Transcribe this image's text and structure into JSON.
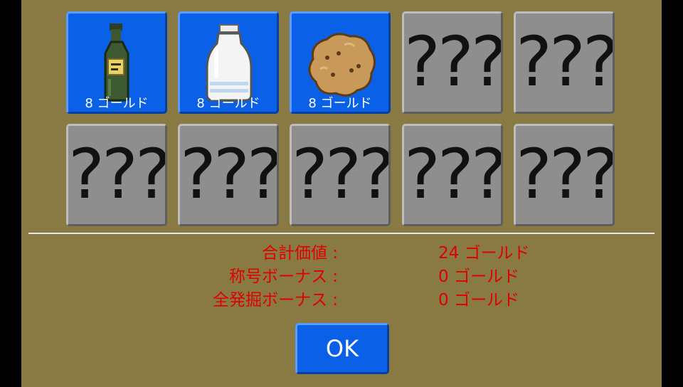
{
  "slots": [
    {
      "state": "found",
      "item": "green-bottle",
      "price": "8 ゴールド"
    },
    {
      "state": "found",
      "item": "plastic-bottle",
      "price": "8 ゴールド"
    },
    {
      "state": "found",
      "item": "cookie",
      "price": "8 ゴールド"
    },
    {
      "state": "unknown",
      "label": "???"
    },
    {
      "state": "unknown",
      "label": "???"
    },
    {
      "state": "unknown",
      "label": "???"
    },
    {
      "state": "unknown",
      "label": "???"
    },
    {
      "state": "unknown",
      "label": "???"
    },
    {
      "state": "unknown",
      "label": "???"
    },
    {
      "state": "unknown",
      "label": "???"
    }
  ],
  "summary": {
    "total_label": "合計価値 :",
    "total_value": "24 ゴールド",
    "title_bonus_label": "称号ボーナス :",
    "title_bonus_value": "0 ゴールド",
    "dig_bonus_label": "全発掘ボーナス :",
    "dig_bonus_value": "0 ゴールド"
  },
  "ok_label": "OK",
  "colors": {
    "panel": "#897a44",
    "found_slot": "#0a60e6",
    "unknown_slot": "#8e8e8e",
    "summary_text": "#e00000"
  }
}
